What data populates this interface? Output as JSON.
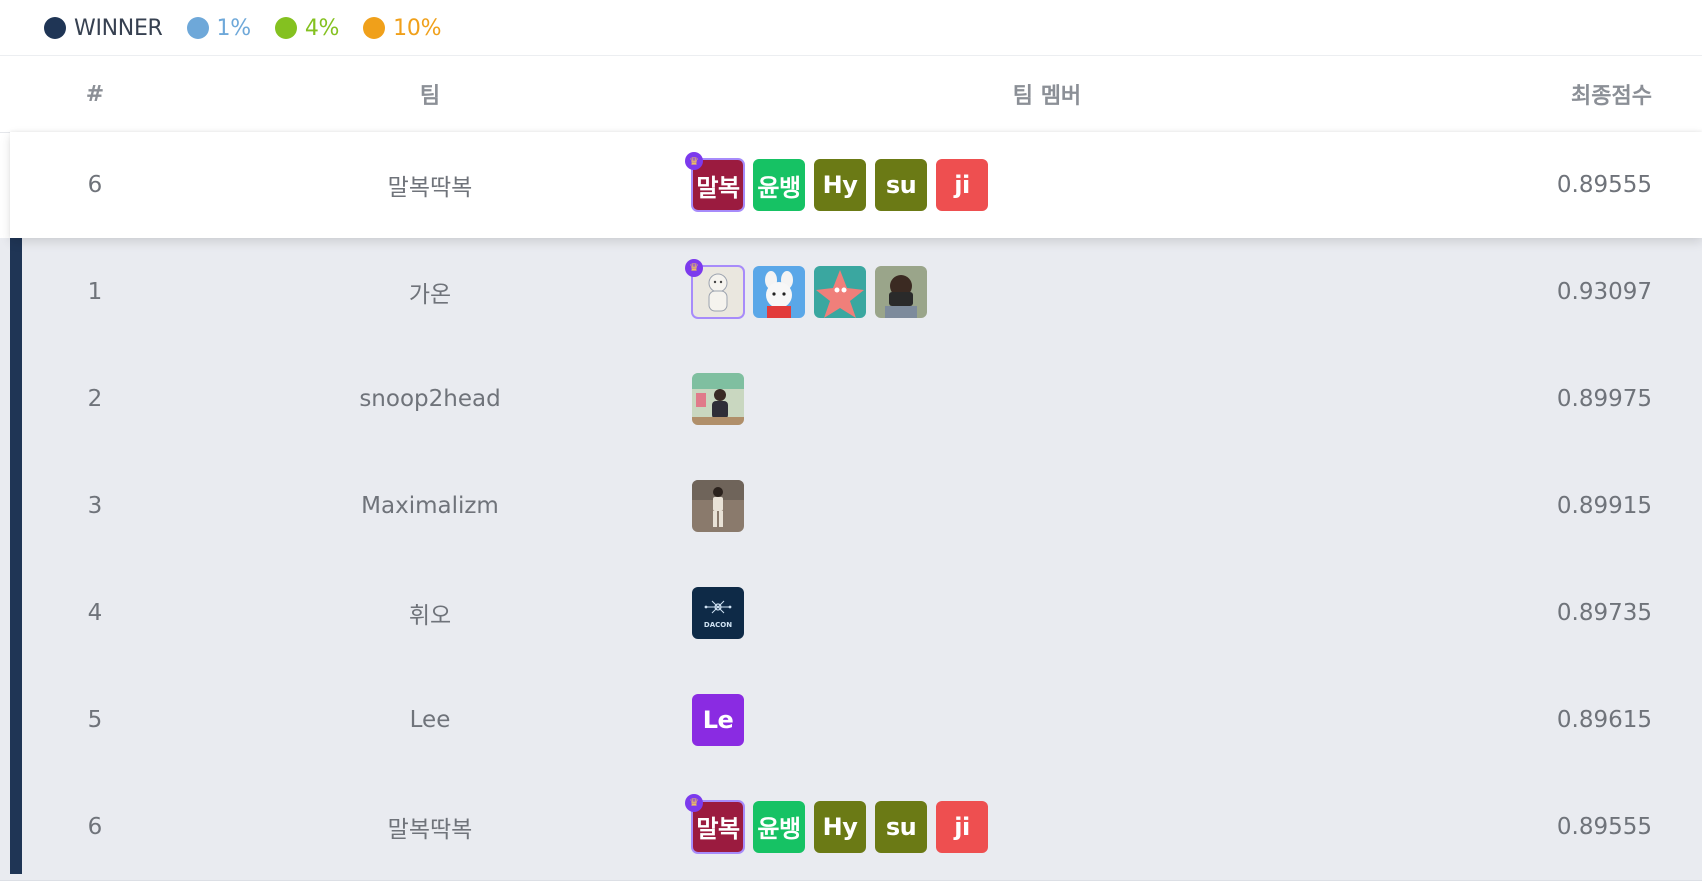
{
  "legend": [
    {
      "label": "WINNER",
      "color": "#1f3555",
      "text_color": "#374151"
    },
    {
      "label": "1%",
      "color": "#6ea8d9",
      "text_color": "#6ea8d9"
    },
    {
      "label": "4%",
      "color": "#84c120",
      "text_color": "#84c120"
    },
    {
      "label": "10%",
      "color": "#f0a01a",
      "text_color": "#f0a01a"
    }
  ],
  "headers": {
    "rank": "#",
    "team": "팀",
    "members": "팀 멤버",
    "score": "최종점수"
  },
  "my_team": {
    "rank": "6",
    "team": "말복딱복",
    "score": "0.89555",
    "members": [
      {
        "text": "말복",
        "color": "#9b1b3f",
        "leader": true
      },
      {
        "text": "윤뱅",
        "color": "#16c264"
      },
      {
        "text": "Hy",
        "color": "#6b7a15"
      },
      {
        "text": "su",
        "color": "#6b7a15"
      },
      {
        "text": "ji",
        "color": "#ee4f50"
      }
    ]
  },
  "rows": [
    {
      "rank": "1",
      "team": "가온",
      "score": "0.93097",
      "members": [
        {
          "icon": "bear-figure-photo",
          "leader": true
        },
        {
          "icon": "white-rabbit-photo"
        },
        {
          "icon": "pink-starfish-photo"
        },
        {
          "icon": "person-with-camera-photo"
        }
      ]
    },
    {
      "rank": "2",
      "team": "snoop2head",
      "score": "0.89975",
      "members": [
        {
          "icon": "person-street-photo"
        }
      ]
    },
    {
      "rank": "3",
      "team": "Maximalizm",
      "score": "0.89915",
      "members": [
        {
          "icon": "standing-person-photo"
        }
      ]
    },
    {
      "rank": "4",
      "team": "휘오",
      "score": "0.89735",
      "members": [
        {
          "icon": "dacon-logo",
          "logo_text": "DACON"
        }
      ]
    },
    {
      "rank": "5",
      "team": "Lee",
      "score": "0.89615",
      "members": [
        {
          "text": "Le",
          "color": "#8a2be2"
        }
      ]
    },
    {
      "rank": "6",
      "team": "말복딱복",
      "score": "0.89555",
      "members": [
        {
          "text": "말복",
          "color": "#9b1b3f",
          "leader": true
        },
        {
          "text": "윤뱅",
          "color": "#16c264"
        },
        {
          "text": "Hy",
          "color": "#6b7a15"
        },
        {
          "text": "su",
          "color": "#6b7a15"
        },
        {
          "text": "ji",
          "color": "#ee4f50"
        }
      ]
    }
  ]
}
